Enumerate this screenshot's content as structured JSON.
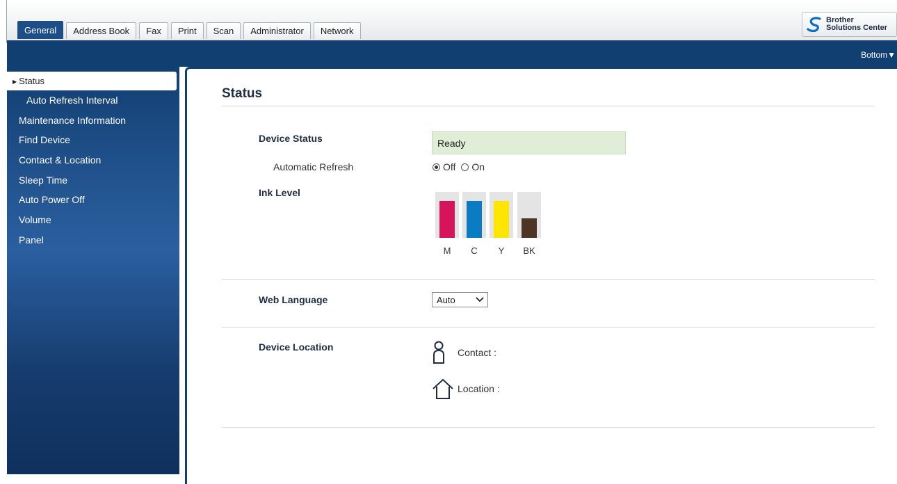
{
  "tabs": [
    {
      "label": "General",
      "active": true
    },
    {
      "label": "Address Book"
    },
    {
      "label": "Fax"
    },
    {
      "label": "Print"
    },
    {
      "label": "Scan"
    },
    {
      "label": "Administrator"
    },
    {
      "label": "Network"
    }
  ],
  "solutions_center": {
    "line1": "Brother",
    "line2": "Solutions Center"
  },
  "bottom_link": "Bottom▼",
  "sidebar": {
    "active": "Status",
    "items": [
      {
        "label": "Auto Refresh Interval"
      },
      {
        "label": "Maintenance Information"
      },
      {
        "label": "Find Device"
      },
      {
        "label": "Contact & Location"
      },
      {
        "label": "Sleep Time"
      },
      {
        "label": "Auto Power Off"
      },
      {
        "label": "Volume"
      },
      {
        "label": "Panel"
      }
    ]
  },
  "main": {
    "title": "Status",
    "device_status": {
      "label": "Device Status",
      "value": "Ready"
    },
    "auto_refresh": {
      "label": "Automatic Refresh",
      "off": "Off",
      "on": "On",
      "selected": "Off"
    },
    "ink": {
      "label": "Ink Level",
      "colors": [
        {
          "name": "M",
          "level": 0.88,
          "color": "#d6145c"
        },
        {
          "name": "C",
          "level": 0.88,
          "color": "#0a7cc4"
        },
        {
          "name": "Y",
          "level": 0.88,
          "color": "#ffe600"
        },
        {
          "name": "BK",
          "level": 0.47,
          "color": "#4d3424"
        }
      ]
    },
    "web_language": {
      "label": "Web Language",
      "value": "Auto"
    },
    "device_location": {
      "label": "Device Location",
      "contact": "Contact :",
      "location": "Location :"
    }
  },
  "colors": {
    "brand_blue": "#123f72",
    "status_bg": "#e1eed7"
  }
}
